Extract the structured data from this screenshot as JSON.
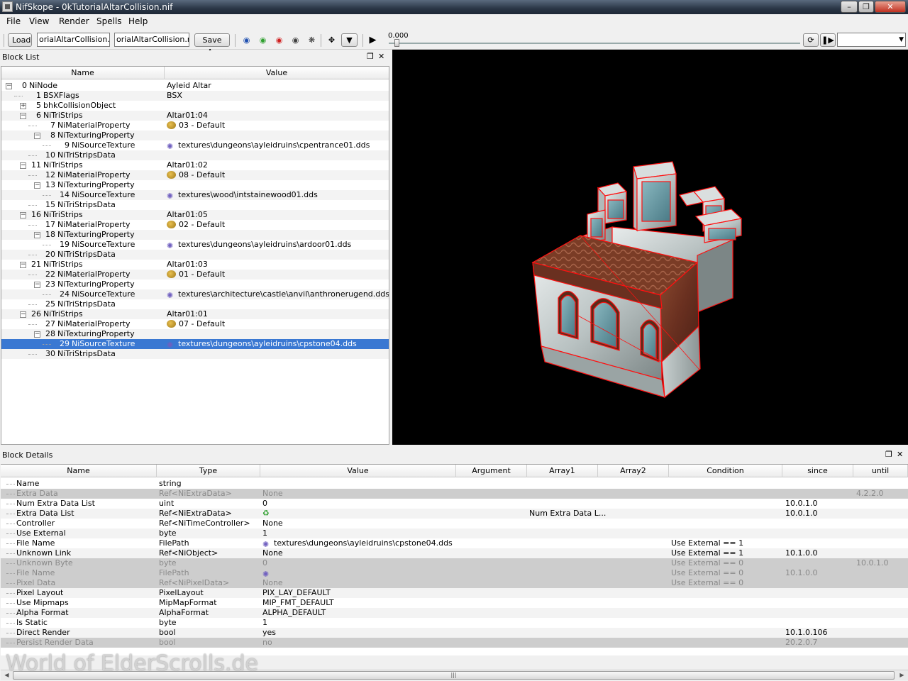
{
  "window": {
    "title": "NifSkope - 0kTutorialAltarCollision.nif"
  },
  "menu": [
    "File",
    "View",
    "Render",
    "Spells",
    "Help"
  ],
  "toolbar": {
    "load_label": "Load",
    "load_path": "orialAltarCollision.nif",
    "save_path": "orialAltarCollision.nif",
    "save_as_label": "Save As",
    "time_value": "0.000"
  },
  "block_list": {
    "title": "Block List",
    "col_name": "Name",
    "col_value": "Value",
    "rows": [
      {
        "num": "0",
        "name": "NiNode",
        "value": "Ayleid Altar",
        "icon": ""
      },
      {
        "num": "1",
        "name": "BSXFlags",
        "value": "BSX",
        "icon": ""
      },
      {
        "num": "5",
        "name": "bhkCollisionObject",
        "value": "",
        "icon": ""
      },
      {
        "num": "6",
        "name": "NiTriStrips",
        "value": "Altar01:04",
        "icon": ""
      },
      {
        "num": "7",
        "name": "NiMaterialProperty",
        "value": "03 - Default",
        "icon": "material-icon"
      },
      {
        "num": "8",
        "name": "NiTexturingProperty",
        "value": "",
        "icon": ""
      },
      {
        "num": "9",
        "name": "NiSourceTexture",
        "value": "textures\\dungeons\\ayleidruins\\cpentrance01.dds",
        "icon": "texture-icon"
      },
      {
        "num": "10",
        "name": "NiTriStripsData",
        "value": "",
        "icon": ""
      },
      {
        "num": "11",
        "name": "NiTriStrips",
        "value": "Altar01:02",
        "icon": ""
      },
      {
        "num": "12",
        "name": "NiMaterialProperty",
        "value": "08 - Default",
        "icon": "material-icon"
      },
      {
        "num": "13",
        "name": "NiTexturingProperty",
        "value": "",
        "icon": ""
      },
      {
        "num": "14",
        "name": "NiSourceTexture",
        "value": "textures\\wood\\intstainewood01.dds",
        "icon": "texture-icon"
      },
      {
        "num": "15",
        "name": "NiTriStripsData",
        "value": "",
        "icon": ""
      },
      {
        "num": "16",
        "name": "NiTriStrips",
        "value": "Altar01:05",
        "icon": ""
      },
      {
        "num": "17",
        "name": "NiMaterialProperty",
        "value": "02 - Default",
        "icon": "material-icon"
      },
      {
        "num": "18",
        "name": "NiTexturingProperty",
        "value": "",
        "icon": ""
      },
      {
        "num": "19",
        "name": "NiSourceTexture",
        "value": "textures\\dungeons\\ayleidruins\\ardoor01.dds",
        "icon": "texture-icon"
      },
      {
        "num": "20",
        "name": "NiTriStripsData",
        "value": "",
        "icon": ""
      },
      {
        "num": "21",
        "name": "NiTriStrips",
        "value": "Altar01:03",
        "icon": ""
      },
      {
        "num": "22",
        "name": "NiMaterialProperty",
        "value": "01 - Default",
        "icon": "material-icon"
      },
      {
        "num": "23",
        "name": "NiTexturingProperty",
        "value": "",
        "icon": ""
      },
      {
        "num": "24",
        "name": "NiSourceTexture",
        "value": "textures\\architecture\\castle\\anvil\\anthronerugend.dds",
        "icon": "texture-icon"
      },
      {
        "num": "25",
        "name": "NiTriStripsData",
        "value": "",
        "icon": ""
      },
      {
        "num": "26",
        "name": "NiTriStrips",
        "value": "Altar01:01",
        "icon": ""
      },
      {
        "num": "27",
        "name": "NiMaterialProperty",
        "value": "07 - Default",
        "icon": "material-icon"
      },
      {
        "num": "28",
        "name": "NiTexturingProperty",
        "value": "",
        "icon": ""
      },
      {
        "num": "29",
        "name": "NiSourceTexture",
        "value": "textures\\dungeons\\ayleidruins\\cpstone04.dds",
        "icon": "texture-icon"
      },
      {
        "num": "30",
        "name": "NiTriStripsData",
        "value": "",
        "icon": ""
      }
    ]
  },
  "block_details": {
    "title": "Block Details",
    "columns": [
      "Name",
      "Type",
      "Value",
      "Argument",
      "Array1",
      "Array2",
      "Condition",
      "since",
      "until"
    ],
    "rows": [
      {
        "name": "Name",
        "type": "string",
        "value": "",
        "argument": "",
        "array1": "",
        "condition": "",
        "since": "",
        "until": ""
      },
      {
        "name": "Extra Data",
        "type": "Ref<NiExtraData>",
        "value": "None",
        "argument": "",
        "array1": "",
        "condition": "",
        "since": "",
        "until": "4.2.2.0"
      },
      {
        "name": "Num Extra Data List",
        "type": "uint",
        "value": "0",
        "argument": "",
        "array1": "",
        "condition": "",
        "since": "10.0.1.0",
        "until": ""
      },
      {
        "name": "Extra Data List",
        "type": "Ref<NiExtraData>",
        "value": "",
        "argument": "",
        "array1": "Num Extra Data L...",
        "condition": "",
        "since": "10.0.1.0",
        "until": ""
      },
      {
        "name": "Controller",
        "type": "Ref<NiTimeController>",
        "value": "None",
        "argument": "",
        "array1": "",
        "condition": "",
        "since": "",
        "until": ""
      },
      {
        "name": "Use External",
        "type": "byte",
        "value": "1",
        "argument": "",
        "array1": "",
        "condition": "",
        "since": "",
        "until": ""
      },
      {
        "name": "File Name",
        "type": "FilePath",
        "value": "textures\\dungeons\\ayleidruins\\cpstone04.dds",
        "argument": "",
        "array1": "",
        "condition": "Use External == 1",
        "since": "",
        "until": ""
      },
      {
        "name": "Unknown Link",
        "type": "Ref<NiObject>",
        "value": "None",
        "argument": "",
        "array1": "",
        "condition": "Use External == 1",
        "since": "10.1.0.0",
        "until": ""
      },
      {
        "name": "Unknown Byte",
        "type": "byte",
        "value": "0",
        "argument": "",
        "array1": "",
        "condition": "Use External == 0",
        "since": "",
        "until": "10.0.1.0"
      },
      {
        "name": "File Name",
        "type": "FilePath",
        "value": "",
        "argument": "",
        "array1": "",
        "condition": "Use External == 0",
        "since": "10.1.0.0",
        "until": ""
      },
      {
        "name": "Pixel Data",
        "type": "Ref<NiPixelData>",
        "value": "None",
        "argument": "",
        "array1": "",
        "condition": "Use External == 0",
        "since": "",
        "until": ""
      },
      {
        "name": "Pixel Layout",
        "type": "PixelLayout",
        "value": "PIX_LAY_DEFAULT",
        "argument": "",
        "array1": "",
        "condition": "",
        "since": "",
        "until": ""
      },
      {
        "name": "Use Mipmaps",
        "type": "MipMapFormat",
        "value": "MIP_FMT_DEFAULT",
        "argument": "",
        "array1": "",
        "condition": "",
        "since": "",
        "until": ""
      },
      {
        "name": "Alpha Format",
        "type": "AlphaFormat",
        "value": "ALPHA_DEFAULT",
        "argument": "",
        "array1": "",
        "condition": "",
        "since": "",
        "until": ""
      },
      {
        "name": "Is Static",
        "type": "byte",
        "value": "1",
        "argument": "",
        "array1": "",
        "condition": "",
        "since": "",
        "until": ""
      },
      {
        "name": "Direct Render",
        "type": "bool",
        "value": "yes",
        "argument": "",
        "array1": "",
        "condition": "",
        "since": "10.1.0.106",
        "until": ""
      },
      {
        "name": "Persist Render Data",
        "type": "bool",
        "value": "no",
        "argument": "",
        "array1": "",
        "condition": "",
        "since": "20.2.0.7",
        "until": ""
      }
    ]
  },
  "watermark": "World of ElderScrolls.de",
  "colors": {
    "selection": "#3a78d2",
    "viewport_bg": "#000000",
    "wireframe": "#ff1010"
  }
}
